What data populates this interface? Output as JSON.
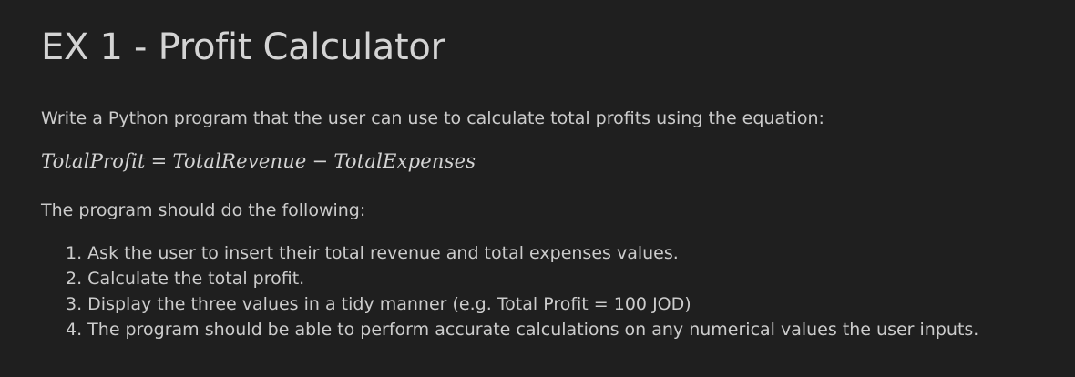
{
  "cell": {
    "title": "EX 1 - Profit Calculator",
    "intro": "Write a Python program that the user can use to calculate total profits using the equation:",
    "equation": {
      "lhs": "TotalProfit",
      "equals": "=",
      "term1": "TotalRevenue",
      "minus": "−",
      "term2": "TotalExpenses"
    },
    "steps_intro": "The program should do the following:",
    "steps": [
      {
        "num": "1.",
        "text": " Ask the user to insert their total revenue and total expenses values."
      },
      {
        "num": "2.",
        "text": " Calculate the total profit."
      },
      {
        "num": "3.",
        "text": " Display the three values in a tidy manner (e.g. Total Profit = 100 JOD)"
      },
      {
        "num": "4.",
        "text": " The program should be able to perform accurate calculations on any numerical values the user inputs."
      }
    ]
  },
  "colors": {
    "background": "#1f1f1f",
    "text": "#cccccc"
  }
}
